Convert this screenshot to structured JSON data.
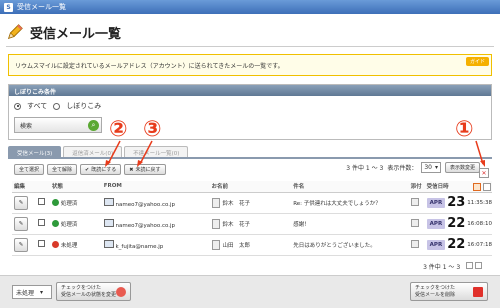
{
  "window": {
    "title": "受信メール一覧"
  },
  "page": {
    "title": "受信メール一覧"
  },
  "notice": {
    "text": "リウムスマイルに設定されているメールアドレス（アカウント）に送られてきたメールの一覧です。",
    "guide_label": "ガイド"
  },
  "filter": {
    "title": "しぼりこみ条件",
    "radio_all": "すべて",
    "radio_filter": "しぼりこみ",
    "search_label": "検索"
  },
  "tabs": [
    {
      "label": "受信メール(3)"
    },
    {
      "label": "返信済メール(0)"
    },
    {
      "label": "不達メール一覧(0)"
    }
  ],
  "toolbar": {
    "select_all": "全て選択",
    "deselect_all": "全て解除",
    "mark_replied": "既読にする",
    "mark_unread": "未読に戻す"
  },
  "counter": {
    "range": "3 件中 1 ～ 3",
    "per_page_label": "表示件数：",
    "per_page": "30",
    "change_label": "表示数変更"
  },
  "callouts": [
    "②",
    "③",
    "①"
  ],
  "table": {
    "headers": {
      "edit": "編集",
      "status": "状態",
      "from": "FROM",
      "name": "お名前",
      "subject": "件名",
      "attach": "添付",
      "date": "受信日時"
    },
    "rows": [
      {
        "status": "処理済",
        "status_color": "#2e9a3a",
        "from": "nameo7@yahoo.co.jp",
        "name": "鈴木　花子",
        "subject": "Re: 子供連れは大丈夫でしょうか？",
        "month": "APR",
        "day": "23",
        "time": "11:35:38"
      },
      {
        "status": "処理済",
        "status_color": "#2e9a3a",
        "from": "nameo7@yahoo.co.jp",
        "name": "鈴木　花子",
        "subject": "感謝！",
        "month": "APR",
        "day": "22",
        "time": "16:08:10"
      },
      {
        "status": "未処理",
        "status_color": "#d83a2a",
        "from": "k_fujita@name.jp",
        "name": "山田　太郎",
        "subject": "先日はありがとうございました。",
        "month": "APR",
        "day": "22",
        "time": "16:07:18"
      }
    ]
  },
  "pager": {
    "range": "3 件中 1 ～ 3"
  },
  "footer": {
    "select_value": "未処理",
    "change_status_line1": "チェックをつけた",
    "change_status_line2": "受信メールの状態を変更",
    "delete_line1": "チェックをつけた",
    "delete_line2": "受信メールを削除"
  }
}
